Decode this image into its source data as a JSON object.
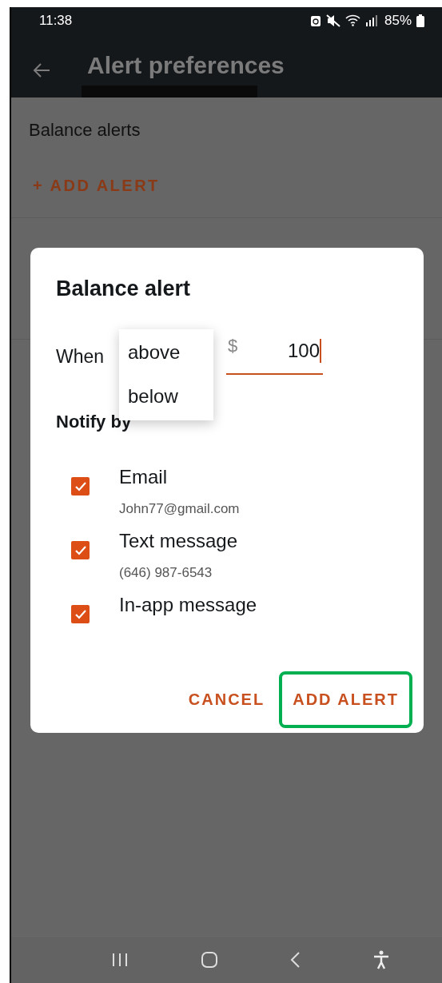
{
  "status_bar": {
    "time": "11:38",
    "battery": "85%"
  },
  "app_bar": {
    "title": "Alert preferences"
  },
  "sections": [
    {
      "title": "Balance alerts",
      "action": "+ ADD ALERT"
    }
  ],
  "dialog": {
    "title": "Balance alert",
    "when_label": "When",
    "menu": [
      "above",
      "below"
    ],
    "currency": "$",
    "amount": "100",
    "notify_label": "Notify by",
    "options": [
      {
        "label": "Email",
        "detail": "John77@gmail.com",
        "checked": true
      },
      {
        "label": "Text message",
        "detail": "(646) 987-6543",
        "checked": true
      },
      {
        "label": "In-app message",
        "checked": true
      }
    ],
    "buttons": [
      {
        "label": "CANCEL",
        "highlighted": false
      },
      {
        "label": "ADD ALERT",
        "highlighted": true
      }
    ]
  }
}
